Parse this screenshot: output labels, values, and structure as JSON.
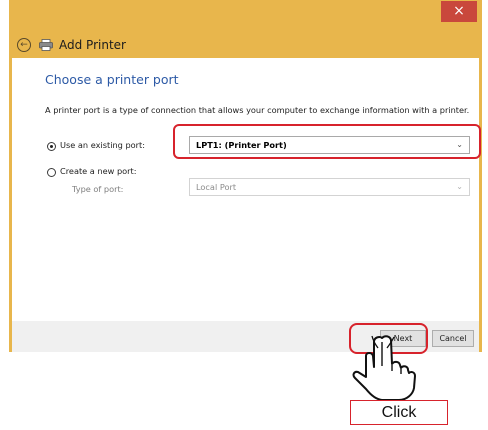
{
  "window": {
    "close_glyph": "×",
    "title": "Add Printer"
  },
  "content": {
    "heading": "Choose a printer port",
    "description": "A printer port is a type of connection that allows your computer to exchange information with a printer."
  },
  "options": {
    "existing_port_label": "Use an existing port:",
    "existing_port_value": "LPT1: (Printer Port)",
    "existing_port_selected": true,
    "new_port_label": "Create a new port:",
    "new_port_selected": false,
    "type_of_port_label": "Type of port:",
    "type_of_port_value": "Local Port"
  },
  "footer": {
    "next_label": "Next",
    "cancel_label": "Cancel"
  },
  "annotation": {
    "caption": "Click",
    "highlight_color": "#d7232c"
  },
  "colors": {
    "window_frame": "#e8b64c",
    "close_button": "#c9483c",
    "heading": "#2d5aa6"
  },
  "icons": [
    "close-icon",
    "back-arrow-icon",
    "printer-icon",
    "chevron-down-icon",
    "hand-pointer-icon"
  ]
}
